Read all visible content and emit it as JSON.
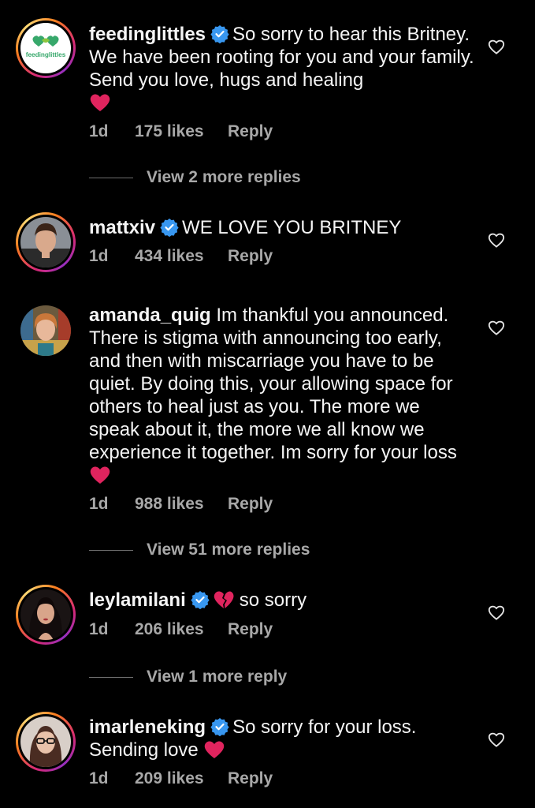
{
  "colors": {
    "background": "#000000",
    "text": "#f5f5f5",
    "secondary": "#a8a8a8",
    "verified": "#3897f0",
    "heart": "#e0245e"
  },
  "comments": [
    {
      "username": "feedinglittles",
      "verified": true,
      "avatar_icon": "feedinglittles-logo",
      "avatar_text": "feedinglittles",
      "text": "So sorry to hear this Britney. We have been rooting for you and your family. Send you love, hugs and healing",
      "emoji": "red-heart",
      "time": "1d",
      "likes": "175 likes",
      "reply": "Reply",
      "view_replies": "View 2 more replies"
    },
    {
      "username": "mattxiv",
      "verified": true,
      "avatar_icon": "profile-photo",
      "text": "WE LOVE YOU BRITNEY",
      "time": "1d",
      "likes": "434 likes",
      "reply": "Reply"
    },
    {
      "username": "amanda_quig",
      "verified": false,
      "avatar_icon": "profile-photo",
      "text": "Im thankful you announced. There is stigma with announcing too early, and then with miscarriage you have to be quiet. By doing this, your allowing space for others to heal just as you. The more we speak about it, the more we all know we experience it together. Im sorry for your loss",
      "emoji": "red-heart",
      "time": "1d",
      "likes": "988 likes",
      "reply": "Reply",
      "view_replies": "View 51 more replies"
    },
    {
      "username": "leylamilani",
      "verified": true,
      "avatar_icon": "profile-photo",
      "emoji": "broken-heart",
      "text": "so sorry",
      "time": "1d",
      "likes": "206 likes",
      "reply": "Reply",
      "view_replies": "View 1 more reply"
    },
    {
      "username": "imarleneking",
      "verified": true,
      "avatar_icon": "profile-photo",
      "text": "So sorry for your loss. Sending love",
      "emoji": "red-heart",
      "time": "1d",
      "likes": "209 likes",
      "reply": "Reply"
    }
  ]
}
